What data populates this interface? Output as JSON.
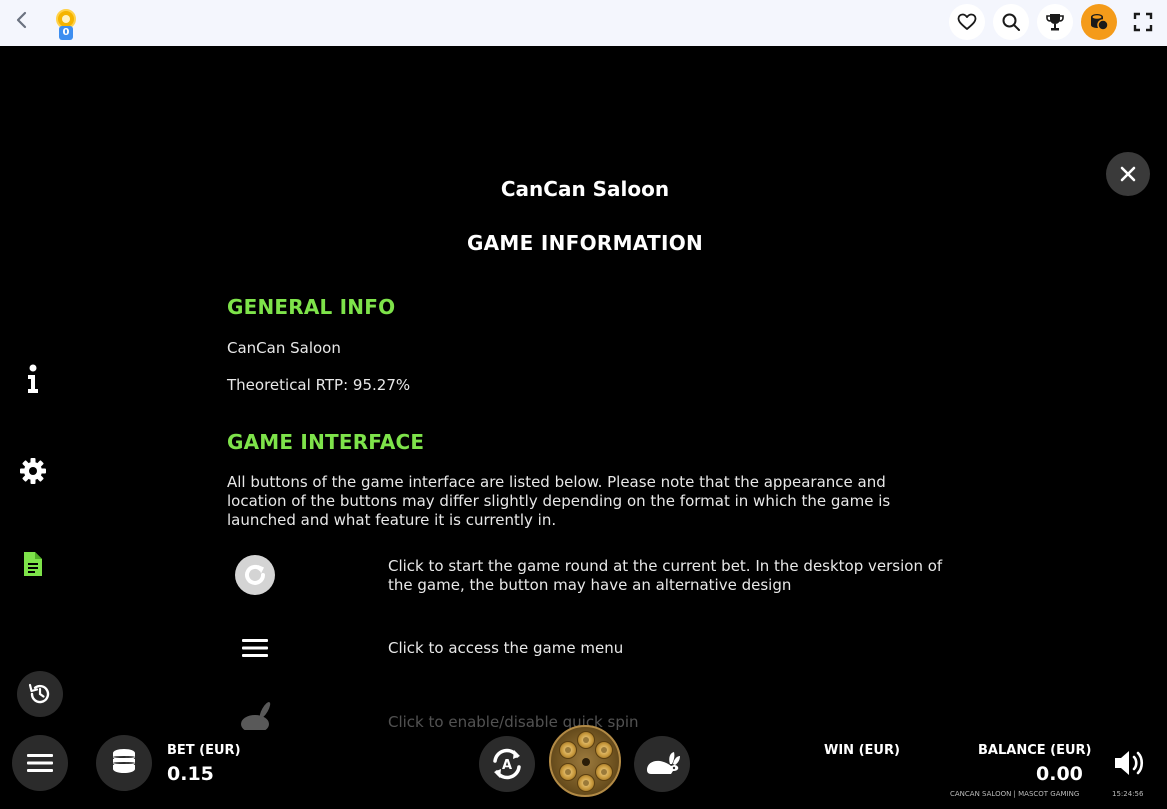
{
  "topbar": {
    "token_count": "0",
    "icons": [
      "chevron-left-icon",
      "heart-icon",
      "search-icon",
      "trophy-icon",
      "coins-icon",
      "fullscreen-icon"
    ]
  },
  "side_menu": {
    "items": [
      "info-icon",
      "gear-icon",
      "document-icon",
      "history-icon"
    ],
    "active_color": "#7ee34a"
  },
  "content": {
    "game_title": "CanCan Saloon",
    "heading": "GAME INFORMATION",
    "general_info": {
      "heading": "GENERAL INFO",
      "name": "CanCan Saloon",
      "rtp": "Theoretical RTP: 95.27%"
    },
    "game_interface": {
      "heading": "GAME INTERFACE",
      "intro": "All buttons of the game interface are listed below. Please note that the appearance and location of the buttons may differ slightly depending on the format in which the game is launched and what feature it is currently in.",
      "rows": [
        {
          "icon": "spin-arrow-icon",
          "text": "Click to start the game round at the current bet. In the desktop version of the game, the button may have an alternative design"
        },
        {
          "icon": "menu-icon",
          "text": "Click to access the game menu"
        },
        {
          "icon": "rabbit-icon",
          "text": "Click to enable/disable quick spin"
        }
      ]
    }
  },
  "bottombar": {
    "bet_label": "BET (EUR)",
    "bet_value": "0.15",
    "win_label": "WIN (EUR)",
    "balance_label": "BALANCE (EUR)",
    "balance_value": "0.00",
    "footer_game": "CANCAN SALOON | MASCOT GAMING",
    "time": "15:24:56"
  },
  "colors": {
    "accent_green": "#7ee34a",
    "background": "#000000",
    "topbar": "#f4f6fd",
    "coins_button": "#f49b1a"
  }
}
